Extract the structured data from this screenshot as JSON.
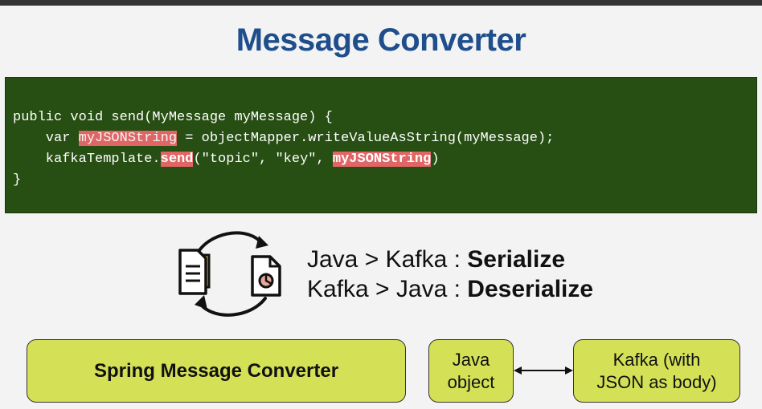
{
  "title": "Message Converter",
  "code": {
    "line1": "public void send(MyMessage myMessage) {",
    "line2_pre": "    var ",
    "line2_hl": "myJSONString",
    "line2_post": " = objectMapper.writeValueAsString(myMessage);",
    "line3_pre": "    kafkaTemplate.",
    "line3_hl": "send",
    "line3_mid": "(\"topic\", \"key\", ",
    "line3_hl2": "myJSONString",
    "line3_post": ")",
    "line4": "}"
  },
  "conversion": {
    "line1_prefix": "Java > Kafka : ",
    "line1_bold": "Serialize",
    "line2_prefix": "Kafka > Java : ",
    "line2_bold": "Deserialize"
  },
  "boxes": {
    "spring": "Spring Message Converter",
    "java_line1": "Java",
    "java_line2": "object",
    "kafka_line1": "Kafka (with",
    "kafka_line2": "JSON as body)"
  },
  "icons": [
    "document-icon",
    "pdf-file-icon",
    "refresh-arrows-icon",
    "double-arrow-icon"
  ],
  "colors": {
    "title": "#1f4e8c",
    "code_background": "#274e13",
    "highlight": "#e06666",
    "box_fill": "#d4e157"
  }
}
